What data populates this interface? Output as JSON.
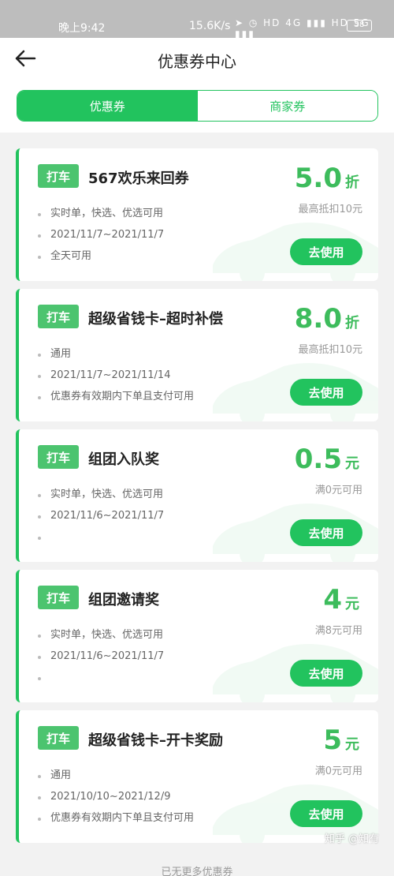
{
  "status_bar": {
    "time": "晚上9:42",
    "speed": "15.6K/s",
    "icons": "➤ ◷ HD 4G ▮▮▮ HD 5G ▮▮▮",
    "battery": "58"
  },
  "header": {
    "title": "优惠券中心",
    "tabs": [
      {
        "label": "优惠券",
        "active": true
      },
      {
        "label": "商家券",
        "active": false
      }
    ]
  },
  "coupons": [
    {
      "tag": "打车",
      "title": "567欢乐来回券",
      "value": "5.0",
      "unit": "折",
      "condition": "最高抵扣10元",
      "details": [
        "实时单，快选、优选可用",
        "2021/11/7~2021/11/7",
        "全天可用"
      ],
      "button": "去使用"
    },
    {
      "tag": "打车",
      "title": "超级省钱卡–超时补偿",
      "value": "8.0",
      "unit": "折",
      "condition": "最高抵扣10元",
      "details": [
        "通用",
        "2021/11/7~2021/11/14",
        "优惠券有效期内下单且支付可用"
      ],
      "button": "去使用"
    },
    {
      "tag": "打车",
      "title": "组团入队奖",
      "value": "0.5",
      "unit": "元",
      "condition": "满0元可用",
      "details": [
        "实时单，快选、优选可用",
        "2021/11/6~2021/11/7",
        ""
      ],
      "button": "去使用"
    },
    {
      "tag": "打车",
      "title": "组团邀请奖",
      "value": "4",
      "unit": "元",
      "condition": "满8元可用",
      "details": [
        "实时单，快选、优选可用",
        "2021/11/6~2021/11/7",
        ""
      ],
      "button": "去使用"
    },
    {
      "tag": "打车",
      "title": "超级省钱卡–开卡奖励",
      "value": "5",
      "unit": "元",
      "condition": "满0元可用",
      "details": [
        "通用",
        "2021/10/10~2021/12/9",
        "优惠券有效期内下单且支付可用"
      ],
      "button": "去使用"
    }
  ],
  "footer": "已无更多优惠券",
  "watermark": "知乎 @知有",
  "colors": {
    "accent": "#22c35e",
    "tag": "#4cc46f",
    "value": "#3dbc5c"
  }
}
